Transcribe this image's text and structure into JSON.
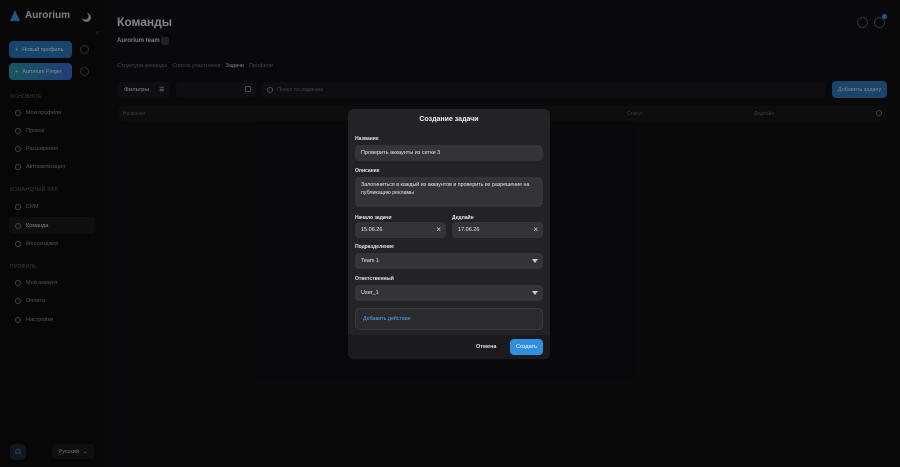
{
  "sidebar": {
    "logo": "Aurorium",
    "new_profile_label": "Новый профиль",
    "finger_label": "Aurorium Finger",
    "section_main": "ОСНОВНОЕ",
    "main_items": [
      "Мои профили",
      "Прокси",
      "Расширения",
      "Автоматизация"
    ],
    "section_team": "КОМАНДНЫЙ ЗАЛ",
    "team_items": [
      "CRM",
      "Команда",
      "Мессенджер"
    ],
    "section_profile": "ПРОФИЛЬ",
    "profile_items": [
      "Мой аккаунт",
      "Оплата",
      "Настройки"
    ],
    "language": "Русский",
    "active_item": "Команда"
  },
  "header": {
    "title": "Команды",
    "team_name": "Aurorium team"
  },
  "tabs": [
    {
      "label": "Структура команды",
      "active": false
    },
    {
      "label": "Список участников",
      "active": false
    },
    {
      "label": "Задачи",
      "active": true
    },
    {
      "label": "Профили",
      "active": false
    }
  ],
  "toolbar": {
    "filters_label": "Фильтры",
    "search_placeholder": "Поиск по задачам",
    "add_task_label": "Добавить задачу"
  },
  "table": {
    "columns": [
      "Название",
      "Статус",
      "Дедлайн"
    ]
  },
  "modal": {
    "title": "Создание задачи",
    "name_label": "Название",
    "name_value": "Проверить аккаунты из сетки 3",
    "description_label": "Описание",
    "description_value": "Залогиниться в каждый из аккаунтов и проверить их разрешение на публикацию рекламы",
    "start_label": "Начало задачи",
    "start_value": "15.06.26",
    "deadline_label": "Дедлайн",
    "deadline_value": "17.06.26",
    "division_label": "Подразделение",
    "division_value": "Team 1",
    "assignee_label": "Ответственный",
    "assignee_value": "User_1",
    "add_action_label": "Добавить действие",
    "cancel_label": "Отмена",
    "create_label": "Создать"
  },
  "colors": {
    "accent": "#2f8fe0",
    "background": "#121214",
    "modal": "#232326"
  }
}
